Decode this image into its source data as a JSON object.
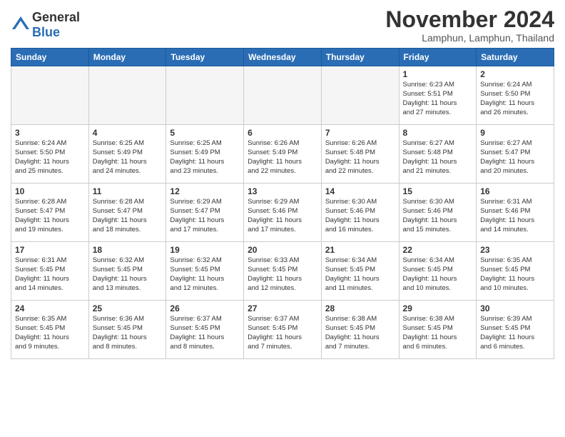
{
  "header": {
    "logo_line1": "General",
    "logo_line2": "Blue",
    "month_title": "November 2024",
    "location": "Lamphun, Lamphun, Thailand"
  },
  "weekdays": [
    "Sunday",
    "Monday",
    "Tuesday",
    "Wednesday",
    "Thursday",
    "Friday",
    "Saturday"
  ],
  "weeks": [
    [
      {
        "day": "",
        "text": ""
      },
      {
        "day": "",
        "text": ""
      },
      {
        "day": "",
        "text": ""
      },
      {
        "day": "",
        "text": ""
      },
      {
        "day": "",
        "text": ""
      },
      {
        "day": "1",
        "text": "Sunrise: 6:23 AM\nSunset: 5:51 PM\nDaylight: 11 hours\nand 27 minutes."
      },
      {
        "day": "2",
        "text": "Sunrise: 6:24 AM\nSunset: 5:50 PM\nDaylight: 11 hours\nand 26 minutes."
      }
    ],
    [
      {
        "day": "3",
        "text": "Sunrise: 6:24 AM\nSunset: 5:50 PM\nDaylight: 11 hours\nand 25 minutes."
      },
      {
        "day": "4",
        "text": "Sunrise: 6:25 AM\nSunset: 5:49 PM\nDaylight: 11 hours\nand 24 minutes."
      },
      {
        "day": "5",
        "text": "Sunrise: 6:25 AM\nSunset: 5:49 PM\nDaylight: 11 hours\nand 23 minutes."
      },
      {
        "day": "6",
        "text": "Sunrise: 6:26 AM\nSunset: 5:49 PM\nDaylight: 11 hours\nand 22 minutes."
      },
      {
        "day": "7",
        "text": "Sunrise: 6:26 AM\nSunset: 5:48 PM\nDaylight: 11 hours\nand 22 minutes."
      },
      {
        "day": "8",
        "text": "Sunrise: 6:27 AM\nSunset: 5:48 PM\nDaylight: 11 hours\nand 21 minutes."
      },
      {
        "day": "9",
        "text": "Sunrise: 6:27 AM\nSunset: 5:47 PM\nDaylight: 11 hours\nand 20 minutes."
      }
    ],
    [
      {
        "day": "10",
        "text": "Sunrise: 6:28 AM\nSunset: 5:47 PM\nDaylight: 11 hours\nand 19 minutes."
      },
      {
        "day": "11",
        "text": "Sunrise: 6:28 AM\nSunset: 5:47 PM\nDaylight: 11 hours\nand 18 minutes."
      },
      {
        "day": "12",
        "text": "Sunrise: 6:29 AM\nSunset: 5:47 PM\nDaylight: 11 hours\nand 17 minutes."
      },
      {
        "day": "13",
        "text": "Sunrise: 6:29 AM\nSunset: 5:46 PM\nDaylight: 11 hours\nand 17 minutes."
      },
      {
        "day": "14",
        "text": "Sunrise: 6:30 AM\nSunset: 5:46 PM\nDaylight: 11 hours\nand 16 minutes."
      },
      {
        "day": "15",
        "text": "Sunrise: 6:30 AM\nSunset: 5:46 PM\nDaylight: 11 hours\nand 15 minutes."
      },
      {
        "day": "16",
        "text": "Sunrise: 6:31 AM\nSunset: 5:46 PM\nDaylight: 11 hours\nand 14 minutes."
      }
    ],
    [
      {
        "day": "17",
        "text": "Sunrise: 6:31 AM\nSunset: 5:45 PM\nDaylight: 11 hours\nand 14 minutes."
      },
      {
        "day": "18",
        "text": "Sunrise: 6:32 AM\nSunset: 5:45 PM\nDaylight: 11 hours\nand 13 minutes."
      },
      {
        "day": "19",
        "text": "Sunrise: 6:32 AM\nSunset: 5:45 PM\nDaylight: 11 hours\nand 12 minutes."
      },
      {
        "day": "20",
        "text": "Sunrise: 6:33 AM\nSunset: 5:45 PM\nDaylight: 11 hours\nand 12 minutes."
      },
      {
        "day": "21",
        "text": "Sunrise: 6:34 AM\nSunset: 5:45 PM\nDaylight: 11 hours\nand 11 minutes."
      },
      {
        "day": "22",
        "text": "Sunrise: 6:34 AM\nSunset: 5:45 PM\nDaylight: 11 hours\nand 10 minutes."
      },
      {
        "day": "23",
        "text": "Sunrise: 6:35 AM\nSunset: 5:45 PM\nDaylight: 11 hours\nand 10 minutes."
      }
    ],
    [
      {
        "day": "24",
        "text": "Sunrise: 6:35 AM\nSunset: 5:45 PM\nDaylight: 11 hours\nand 9 minutes."
      },
      {
        "day": "25",
        "text": "Sunrise: 6:36 AM\nSunset: 5:45 PM\nDaylight: 11 hours\nand 8 minutes."
      },
      {
        "day": "26",
        "text": "Sunrise: 6:37 AM\nSunset: 5:45 PM\nDaylight: 11 hours\nand 8 minutes."
      },
      {
        "day": "27",
        "text": "Sunrise: 6:37 AM\nSunset: 5:45 PM\nDaylight: 11 hours\nand 7 minutes."
      },
      {
        "day": "28",
        "text": "Sunrise: 6:38 AM\nSunset: 5:45 PM\nDaylight: 11 hours\nand 7 minutes."
      },
      {
        "day": "29",
        "text": "Sunrise: 6:38 AM\nSunset: 5:45 PM\nDaylight: 11 hours\nand 6 minutes."
      },
      {
        "day": "30",
        "text": "Sunrise: 6:39 AM\nSunset: 5:45 PM\nDaylight: 11 hours\nand 6 minutes."
      }
    ]
  ]
}
